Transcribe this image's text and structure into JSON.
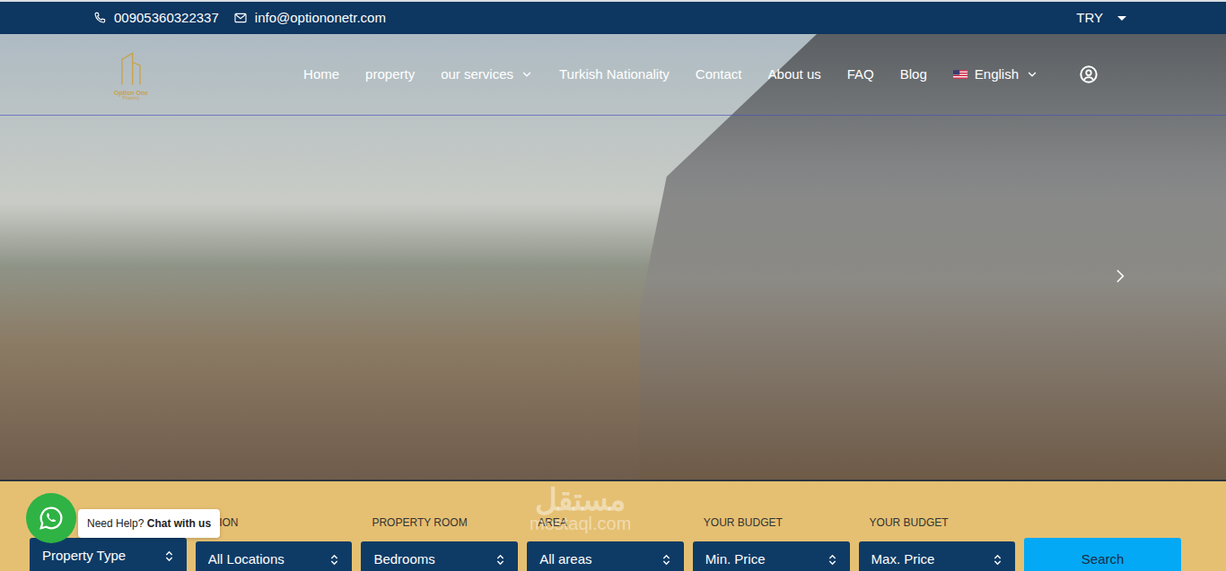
{
  "topbar": {
    "phone": "00905360322337",
    "email": "info@optiononetr.com",
    "currency": "TRY"
  },
  "logo": {
    "name": "Option One",
    "tagline": "Property"
  },
  "nav": {
    "items": [
      {
        "label": "Home",
        "dropdown": false
      },
      {
        "label": "property",
        "dropdown": false
      },
      {
        "label": "our services",
        "dropdown": true
      },
      {
        "label": "Turkish Nationality",
        "dropdown": false
      },
      {
        "label": "Contact",
        "dropdown": false
      },
      {
        "label": "About us",
        "dropdown": false
      },
      {
        "label": "FAQ",
        "dropdown": false
      },
      {
        "label": "Blog",
        "dropdown": false
      }
    ],
    "language": "English"
  },
  "search": {
    "fields": [
      {
        "value": "Property Type"
      },
      {
        "label": "ATION",
        "value": "All Locations"
      },
      {
        "label": "PROPERTY ROOM",
        "value": "Bedrooms"
      },
      {
        "label": "AREA",
        "value": "All areas"
      },
      {
        "label": "YOUR BUDGET",
        "value": "Min. Price"
      },
      {
        "label": "YOUR BUDGET",
        "value": "Max. Price"
      }
    ],
    "button": "Search"
  },
  "whatsapp": {
    "prefix": "Need Help?",
    "link": "Chat with us"
  },
  "watermark": {
    "arabic": "مستقل",
    "latin": "mostaql.com"
  }
}
